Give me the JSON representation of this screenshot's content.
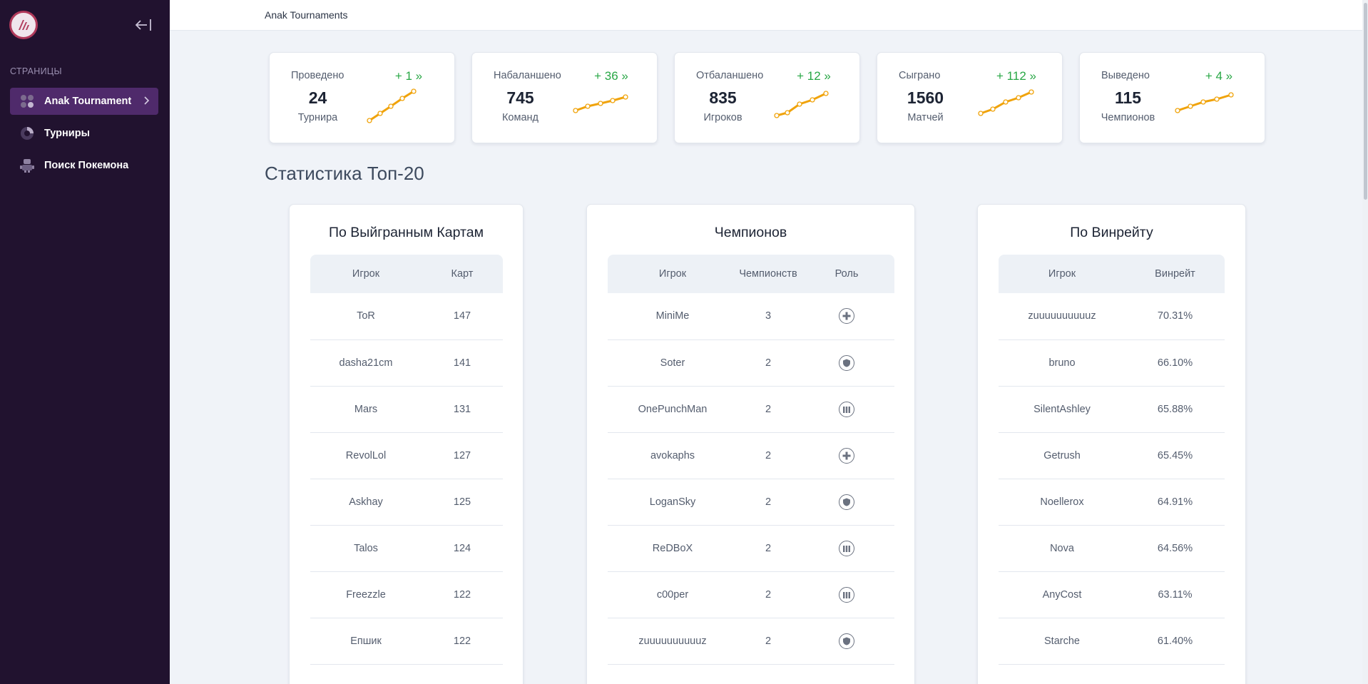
{
  "sidebar": {
    "section_label": "СТРАНИЦЫ",
    "items": [
      {
        "label": "Anak Tournament",
        "icon": "apps-icon"
      },
      {
        "label": "Турниры",
        "icon": "pie-chart-icon"
      },
      {
        "label": "Поиск Покемона",
        "icon": "robot-icon"
      }
    ]
  },
  "topbar": {
    "breadcrumb": "Anak Tournaments"
  },
  "stats": [
    {
      "label": "Проведено",
      "value": "24",
      "unit": "Турнира",
      "delta": "+ 1 »"
    },
    {
      "label": "Набаланшено",
      "value": "745",
      "unit": "Команд",
      "delta": "+ 36 »"
    },
    {
      "label": "Отбаланшено",
      "value": "835",
      "unit": "Игроков",
      "delta": "+ 12 »"
    },
    {
      "label": "Сыграно",
      "value": "1560",
      "unit": "Матчей",
      "delta": "+ 112 »"
    },
    {
      "label": "Выведено",
      "value": "115",
      "unit": "Чемпионов",
      "delta": "+ 4 »"
    }
  ],
  "page_title": "Статистика Топ-20",
  "tables": {
    "maps": {
      "title": "По Выйгранным Картам",
      "headers": [
        "Игрок",
        "Карт"
      ],
      "rows": [
        [
          "ToR",
          "147"
        ],
        [
          "dasha21cm",
          "141"
        ],
        [
          "Mars",
          "131"
        ],
        [
          "RevolLol",
          "127"
        ],
        [
          "Askhay",
          "125"
        ],
        [
          "Talos",
          "124"
        ],
        [
          "Freezzle",
          "122"
        ],
        [
          "Епшик",
          "122"
        ]
      ]
    },
    "champions": {
      "title": "Чемпионов",
      "headers": [
        "Игрок",
        "Чемпионств",
        "Роль"
      ],
      "rows": [
        {
          "player": "MiniMe",
          "count": "3",
          "role": "support-icon"
        },
        {
          "player": "Soter",
          "count": "2",
          "role": "tank-icon"
        },
        {
          "player": "OnePunchMan",
          "count": "2",
          "role": "damage-icon"
        },
        {
          "player": "avokaphs",
          "count": "2",
          "role": "support-icon"
        },
        {
          "player": "LoganSky",
          "count": "2",
          "role": "tank-icon"
        },
        {
          "player": "ReDBoX",
          "count": "2",
          "role": "damage-icon"
        },
        {
          "player": "c00per",
          "count": "2",
          "role": "damage-icon"
        },
        {
          "player": "zuuuuuuuuuuz",
          "count": "2",
          "role": "tank-icon"
        }
      ]
    },
    "winrate": {
      "title": "По Винрейту",
      "headers": [
        "Игрок",
        "Винрейт"
      ],
      "rows": [
        [
          "zuuuuuuuuuuz",
          "70.31%"
        ],
        [
          "bruno",
          "66.10%"
        ],
        [
          "SilentAshley",
          "65.88%"
        ],
        [
          "Getrush",
          "65.45%"
        ],
        [
          "Noellerox",
          "64.91%"
        ],
        [
          "Nova",
          "64.56%"
        ],
        [
          "AnyCost",
          "63.11%"
        ],
        [
          "Starche",
          "61.40%"
        ]
      ]
    }
  },
  "colors": {
    "sidebar_bg": "#21122f",
    "active_item": "#4f2a6b",
    "delta_green": "#28a745",
    "spark_line": "#f0a30a"
  }
}
